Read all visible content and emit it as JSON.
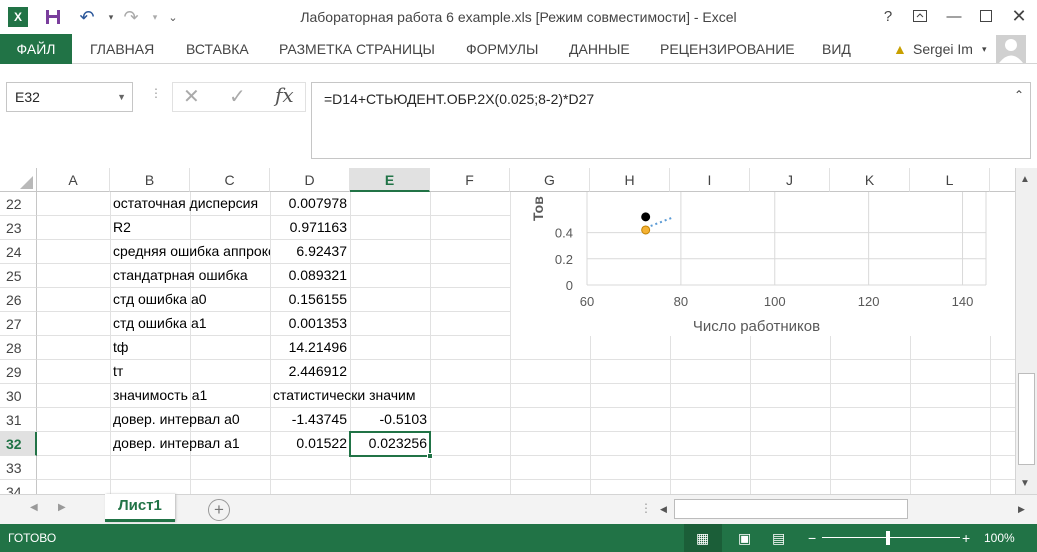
{
  "window": {
    "title": "Лабораторная работа 6 example.xls  [Режим совместимости] - Excel"
  },
  "ribbon": {
    "file": "ФАЙЛ",
    "tabs": [
      "ГЛАВНАЯ",
      "ВСТАВКА",
      "РАЗМЕТКА СТРАНИЦЫ",
      "ФОРМУЛЫ",
      "ДАННЫЕ",
      "РЕЦЕНЗИРОВАНИЕ",
      "ВИД"
    ],
    "user": "Sergei Im"
  },
  "formula_bar": {
    "name_box": "E32",
    "formula": "=D14+СТЬЮДЕНТ.ОБР.2Х(0.025;8-2)*D27"
  },
  "columns": [
    "A",
    "B",
    "C",
    "D",
    "E",
    "F",
    "G",
    "H",
    "I",
    "J",
    "K",
    "L"
  ],
  "rows": [
    "22",
    "23",
    "24",
    "25",
    "26",
    "27",
    "28",
    "29",
    "30",
    "31",
    "32",
    "33",
    "34"
  ],
  "cells": {
    "b22": "остаточная дисперсия",
    "d22": "0.007978",
    "b23": "R2",
    "d23": "0.971163",
    "b24": "средняя ошибка аппроксимации",
    "d24": "6.92437",
    "b25": "стандатрная ошибка",
    "d25": "0.089321",
    "b26": "стд ошибка а0",
    "d26": "0.156155",
    "b27": "стд ошибка а1",
    "d27": "0.001353",
    "b28": "tф",
    "d28": "14.21496",
    "b29": "tт",
    "d29": "2.446912",
    "b30": "значимость а1",
    "d30": "статистически значим",
    "b31": "довер. интервал а0",
    "d31": "-1.43745",
    "e31": "-0.5103",
    "b32": "довер. интервал а1",
    "d32": "0.01522",
    "e32": "0.023256"
  },
  "chart_data": {
    "type": "scatter",
    "xlabel": "Число работников",
    "ylabel": "Тов",
    "x_ticks": [
      "60",
      "80",
      "100",
      "120",
      "140"
    ],
    "y_ticks": [
      "0",
      "0.2",
      "0.4"
    ],
    "xlim": [
      60,
      145
    ],
    "series": [
      {
        "points": [
          [
            72.5,
            0.42
          ]
        ],
        "color": "#f5b233"
      },
      {
        "points": [
          [
            72.5,
            0.52
          ]
        ],
        "color": "#000000"
      }
    ]
  },
  "sheet": {
    "tab": "Лист1"
  },
  "status": {
    "ready": "ГОТОВО",
    "zoom": "100%"
  },
  "colors": {
    "accent": "#217346"
  }
}
